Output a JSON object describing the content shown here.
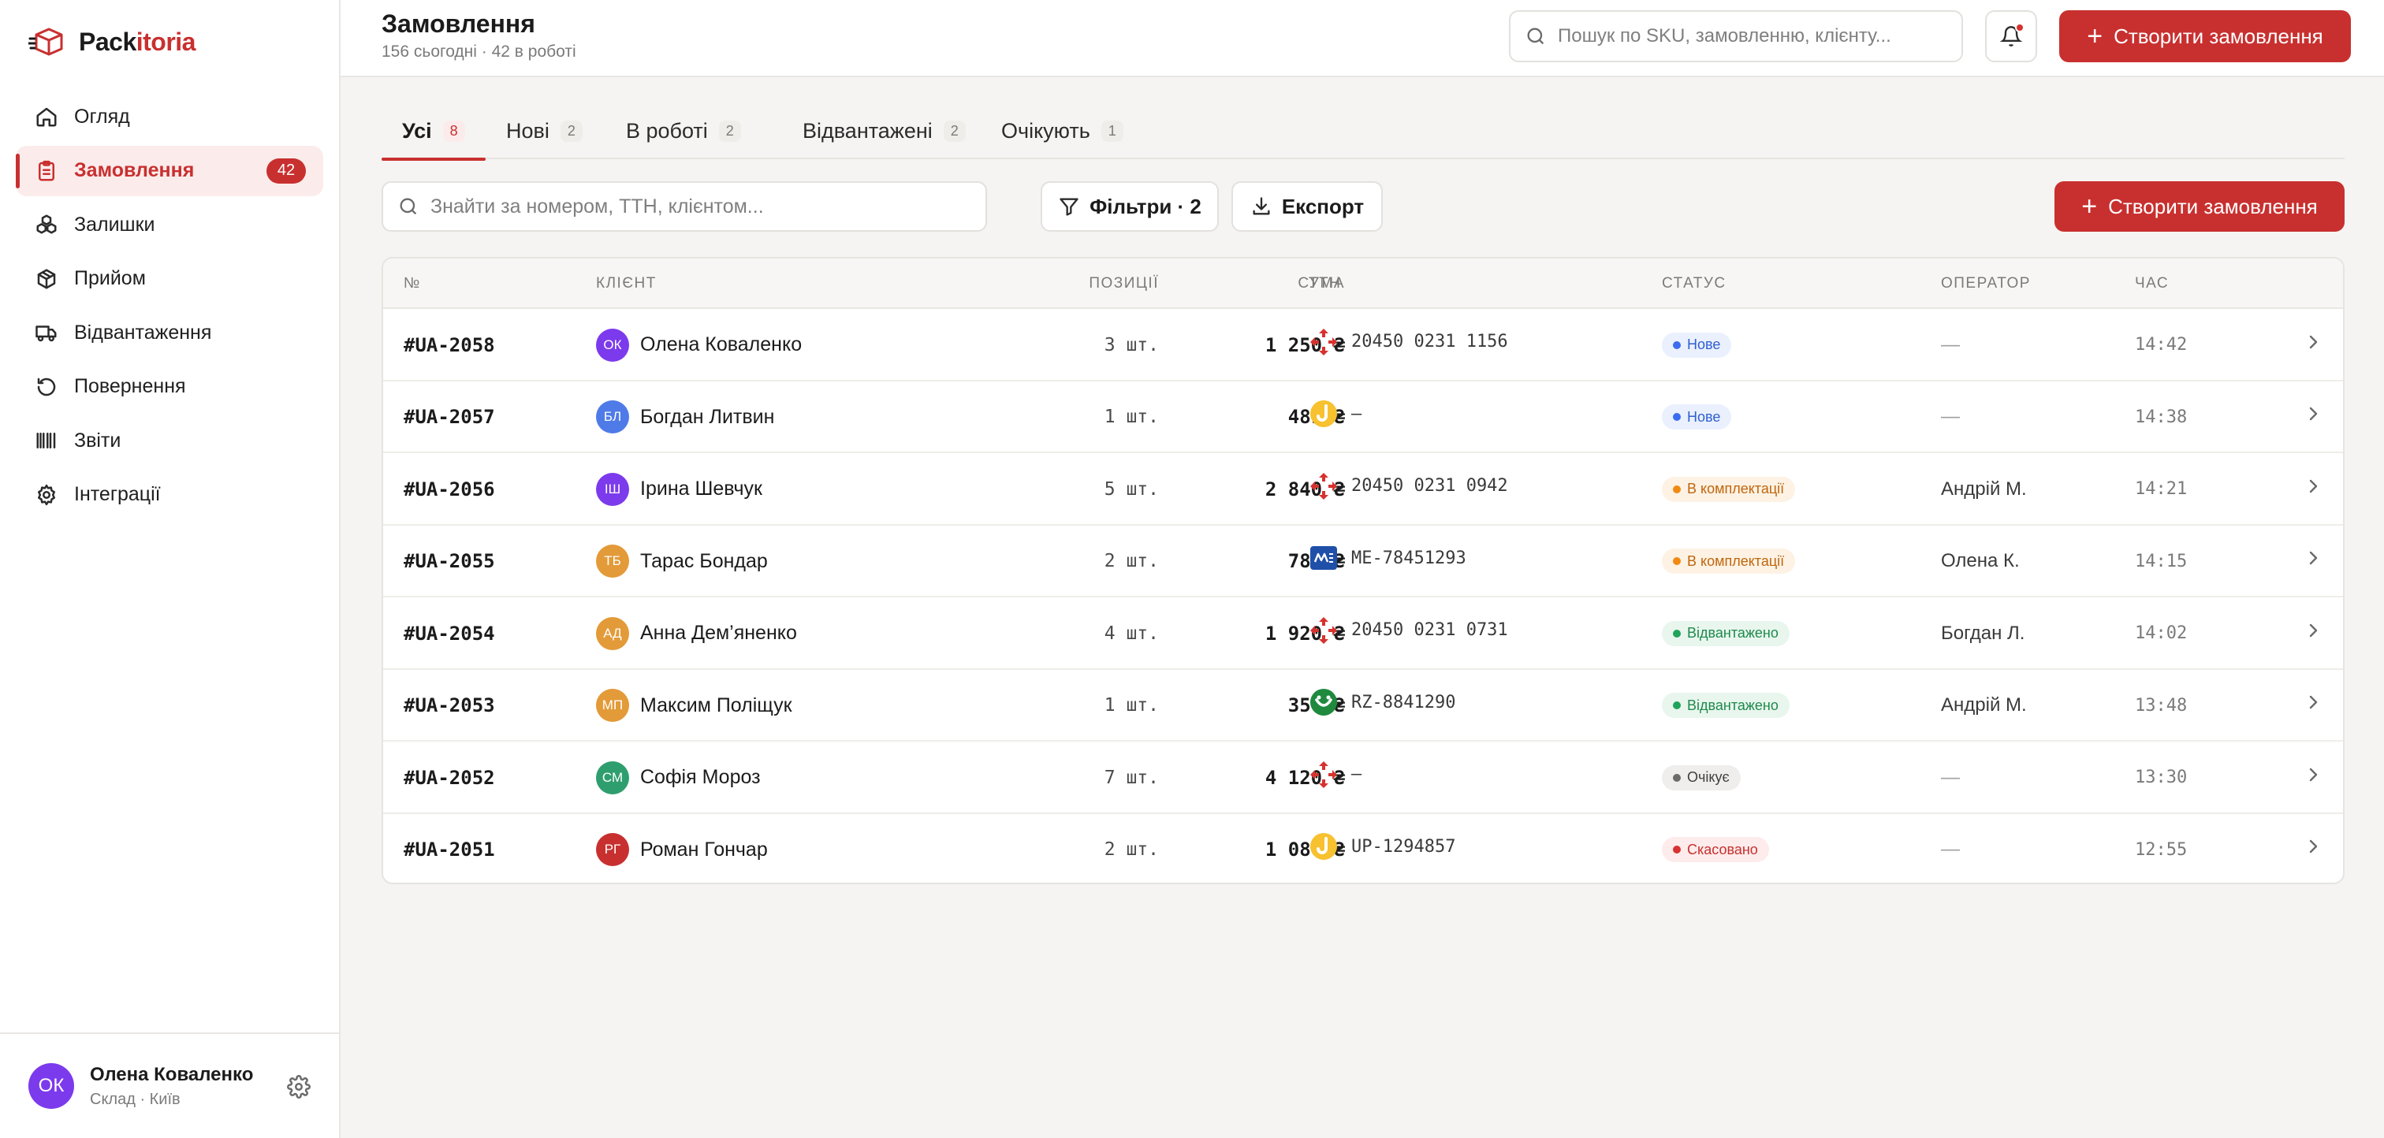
{
  "brand": {
    "name_part1": "Pack",
    "name_part2": "itoria",
    "accent": "#c8302f"
  },
  "sidebar": {
    "items": [
      {
        "label": "Огляд",
        "icon": "home-icon",
        "active": false
      },
      {
        "label": "Замовлення",
        "icon": "clipboard-icon",
        "active": true,
        "badge": "42"
      },
      {
        "label": "Залишки",
        "icon": "boxes-icon",
        "active": false
      },
      {
        "label": "Прийом",
        "icon": "package-icon",
        "active": false
      },
      {
        "label": "Відвантаження",
        "icon": "truck-icon",
        "active": false
      },
      {
        "label": "Повернення",
        "icon": "return-icon",
        "active": false
      },
      {
        "label": "Звіти",
        "icon": "barcode-icon",
        "active": false
      },
      {
        "label": "Інтеграції",
        "icon": "gear-icon",
        "active": false
      }
    ],
    "user": {
      "initials": "ОК",
      "name": "Олена Коваленко",
      "sub": "Склад · Київ"
    }
  },
  "header": {
    "title": "Замовлення",
    "subtitle": "156 сьогодні · 42 в роботі",
    "search_placeholder": "Пошук по SKU, замовленню, клієнту...",
    "create_label": "Створити замовлення"
  },
  "tabs": [
    {
      "label": "Усі",
      "count": "8",
      "active": true
    },
    {
      "label": "Нові",
      "count": "2",
      "active": false
    },
    {
      "label": "В роботі",
      "count": "2",
      "active": false
    },
    {
      "label": "Відвантажені",
      "count": "2",
      "active": false
    },
    {
      "label": "Очікують",
      "count": "1",
      "active": false
    }
  ],
  "toolbar": {
    "search_placeholder": "Знайти за номером, ТТН, клієнтом...",
    "filters_label": "Фільтри · 2",
    "export_label": "Експорт",
    "create_label": "Створити замовлення"
  },
  "table": {
    "columns": [
      "№",
      "КЛІЄНТ",
      "ПОЗИЦІЇ",
      "СУМА",
      "ТТН",
      "СТАТУС",
      "ОПЕРАТОР",
      "ЧАС"
    ],
    "rows": [
      {
        "num": "#UA-2058",
        "initials": "ОК",
        "avatar_color": "#7c3aed",
        "client": "Олена Коваленко",
        "qty": "3 шт.",
        "sum": "1 250 ₴",
        "carrier": "nova-poshta-icon",
        "ttn": "20450 0231 1156",
        "status": "Нове",
        "status_kind": "new",
        "operator": "—",
        "time": "14:42"
      },
      {
        "num": "#UA-2057",
        "initials": "БЛ",
        "avatar_color": "#4f7be8",
        "client": "Богдан Литвин",
        "qty": "1 шт.",
        "sum": "489 ₴",
        "carrier": "ukrposhta-icon",
        "ttn": "—",
        "status": "Нове",
        "status_kind": "new",
        "operator": "—",
        "time": "14:38"
      },
      {
        "num": "#UA-2056",
        "initials": "ІШ",
        "avatar_color": "#7c3aed",
        "client": "Ірина Шевчук",
        "qty": "5 шт.",
        "sum": "2 840 ₴",
        "carrier": "nova-poshta-icon",
        "ttn": "20450 0231 0942",
        "status": "В комплектації",
        "status_kind": "picking",
        "operator": "Андрій М.",
        "time": "14:21"
      },
      {
        "num": "#UA-2055",
        "initials": "ТБ",
        "avatar_color": "#e39a38",
        "client": "Тарас Бондар",
        "qty": "2 шт.",
        "sum": "780 ₴",
        "carrier": "meest-icon",
        "ttn": "ME-78451293",
        "status": "В комплектації",
        "status_kind": "picking",
        "operator": "Олена К.",
        "time": "14:15"
      },
      {
        "num": "#UA-2054",
        "initials": "АД",
        "avatar_color": "#e39a38",
        "client": "Анна Дем’яненко",
        "qty": "4 шт.",
        "sum": "1 920 ₴",
        "carrier": "nova-poshta-icon",
        "ttn": "20450 0231 0731",
        "status": "Відвантажено",
        "status_kind": "shipped",
        "operator": "Богдан Л.",
        "time": "14:02"
      },
      {
        "num": "#UA-2053",
        "initials": "МП",
        "avatar_color": "#e39a38",
        "client": "Максим Поліщук",
        "qty": "1 шт.",
        "sum": "350 ₴",
        "carrier": "rozetka-icon",
        "ttn": "RZ-8841290",
        "status": "Відвантажено",
        "status_kind": "shipped",
        "operator": "Андрій М.",
        "time": "13:48"
      },
      {
        "num": "#UA-2052",
        "initials": "СМ",
        "avatar_color": "#2f9e6e",
        "client": "Софія Мороз",
        "qty": "7 шт.",
        "sum": "4 120 ₴",
        "carrier": "nova-poshta-icon",
        "ttn": "—",
        "status": "Очікує",
        "status_kind": "waiting",
        "operator": "—",
        "time": "13:30"
      },
      {
        "num": "#UA-2051",
        "initials": "РГ",
        "avatar_color": "#c8302f",
        "client": "Роман Гончар",
        "qty": "2 шт.",
        "sum": "1 080 ₴",
        "carrier": "ukrposhta-icon",
        "ttn": "UP-1294857",
        "status": "Скасовано",
        "status_kind": "cancelled",
        "operator": "—",
        "time": "12:55"
      }
    ]
  },
  "status_colors": {
    "new": {
      "bg": "#eaf0fd",
      "fg": "#2f5fd0",
      "dot": "#3b6cf0"
    },
    "picking": {
      "bg": "#fdf2e4",
      "fg": "#c0660c",
      "dot": "#f08a12"
    },
    "shipped": {
      "bg": "#e8f6ee",
      "fg": "#1f8a4c",
      "dot": "#22a35a"
    },
    "waiting": {
      "bg": "#efeeec",
      "fg": "#3f3f3f",
      "dot": "#6b6b6b"
    },
    "cancelled": {
      "bg": "#fdeceb",
      "fg": "#c8302f",
      "dot": "#d7322f"
    }
  }
}
